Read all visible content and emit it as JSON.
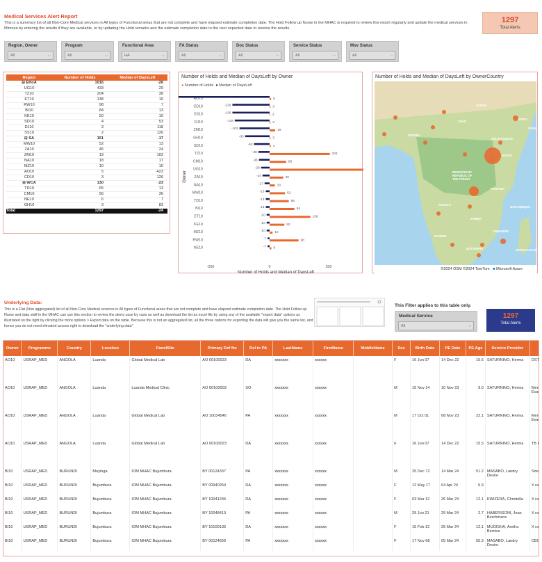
{
  "header": {
    "title": "Medical Services Alert Report",
    "description": "This is a summary list of all Non-Core Medical services in All types of Functional areas that are not complete and have elapsed estimate completion date. The Hold Follow up Nurse in the MHAC is required to review this report regularly and update the medical services in Mimosa by entering the results if they are available, or by updating the Hold remarks and the estimate completion date to the next expected date to receive the results.",
    "kpi_value": "1297",
    "kpi_label": "Total Alerts"
  },
  "filters": [
    {
      "label": "Region, Owner",
      "value": "All"
    },
    {
      "label": "Program",
      "value": "All"
    },
    {
      "label": "Functional Area",
      "value": "HA"
    },
    {
      "label": "FA Status",
      "value": "All"
    },
    {
      "label": "Doc Status",
      "value": "All"
    },
    {
      "label": "Service Status",
      "value": "All"
    },
    {
      "label": "Mov Status",
      "value": "All"
    }
  ],
  "region_table": {
    "headers": [
      "Region",
      "Number of Holds",
      "Median of DaysLeft"
    ],
    "rows": [
      {
        "name": "⊟ EHoA",
        "holds": "1016",
        "median": "-26",
        "group": true
      },
      {
        "name": "UG10",
        "holds": "433",
        "median": "29"
      },
      {
        "name": "TZ10",
        "holds": "204",
        "median": "38"
      },
      {
        "name": "ET10",
        "holds": "138",
        "median": "10"
      },
      {
        "name": "RW10",
        "holds": "98",
        "median": "7"
      },
      {
        "name": "BI10",
        "holds": "84",
        "median": "13"
      },
      {
        "name": "KE10",
        "holds": "50",
        "median": "10"
      },
      {
        "name": "SD10",
        "holds": "4",
        "median": "53"
      },
      {
        "name": "DJ10",
        "holds": "3",
        "median": "118"
      },
      {
        "name": "SS10",
        "holds": "2",
        "median": "126"
      },
      {
        "name": "⊟ SA",
        "holds": "151",
        "median": "-17",
        "group": true
      },
      {
        "name": "MW10",
        "holds": "52",
        "median": "13"
      },
      {
        "name": "ZA10",
        "holds": "46",
        "median": "24"
      },
      {
        "name": "ZM10",
        "holds": "19",
        "median": "102"
      },
      {
        "name": "NA10",
        "holds": "18",
        "median": "17"
      },
      {
        "name": "MZ10",
        "holds": "10",
        "median": "10"
      },
      {
        "name": "AO10",
        "holds": "5",
        "median": "-423"
      },
      {
        "name": "CD10",
        "holds": "3",
        "median": "126"
      },
      {
        "name": "⊟ WCA",
        "holds": "130",
        "median": "-23",
        "group": true
      },
      {
        "name": "TD10",
        "holds": "65",
        "median": "13"
      },
      {
        "name": "CM10",
        "holds": "56",
        "median": "36"
      },
      {
        "name": "NE10",
        "holds": "6",
        "median": "7"
      },
      {
        "name": "GH10",
        "holds": "3",
        "median": "83"
      }
    ],
    "total": {
      "name": "Total",
      "holds": "1297",
      "median": "-24"
    }
  },
  "bar_chart_title": "Number of Holds and Median of DaysLeft by Owner",
  "chart_data": {
    "type": "bar",
    "orientation": "horizontal",
    "title": "Number of Holds and Median of DaysLeft by Owner",
    "xlabel": "Number of Holds and Median of DaysLeft",
    "ylabel": "Owner",
    "xlim": [
      -400,
      400
    ],
    "x_ticks": [
      "-400",
      "-200",
      "0",
      "200",
      "400"
    ],
    "categories": [
      "AO10",
      "CD10",
      "SS10",
      "DJ10",
      "ZM10",
      "GH10",
      "SD10",
      "TZ10",
      "CM10",
      "UG10",
      "ZA10",
      "NA10",
      "MW10",
      "TD10",
      "BI10",
      "ET10",
      "KE10",
      "MZ10",
      "RW10",
      "NE10"
    ],
    "series": [
      {
        "name": "Number of Holds",
        "color": "#e8692e",
        "values": [
          5,
          3,
          2,
          3,
          19,
          3,
          4,
          204,
          56,
          433,
          46,
          18,
          52,
          65,
          84,
          138,
          50,
          10,
          98,
          6
        ]
      },
      {
        "name": "Median of DaysLeft",
        "color": "#1a1f5c",
        "values": [
          -423,
          -126,
          -126,
          -118,
          -102,
          -83,
          -53,
          -38,
          -36,
          -29,
          -24,
          -17,
          -13,
          -13,
          -13,
          -10,
          -10,
          -10,
          -7,
          -7
        ]
      }
    ],
    "holds_labels": [
      "5",
      "3",
      "2",
      "3",
      "19",
      "3",
      "4",
      "204",
      "56",
      "433",
      "46",
      "18",
      "52",
      "65",
      "84",
      "138",
      "50",
      "10",
      "98",
      "6"
    ],
    "median_labels": [
      "-423",
      "-126",
      "-126",
      "-118",
      "-102",
      "-83",
      "-53",
      "-38",
      "-36",
      "-29",
      "-24",
      "-17",
      "-13",
      "-13",
      "-13",
      "-10",
      "-10",
      "-10",
      "-7",
      "-7"
    ],
    "legend_position": "top-left"
  },
  "map": {
    "title": "Number of Holds and Median of DaysLeft by OwnerCountry",
    "labels": [
      "SUDAN",
      "ETHIOPIA",
      "SOMALIA",
      "NIGERIA",
      "DEMOCRATIC REPUBLIC OF THE CONGO",
      "KENYA",
      "TANZANIA",
      "ANGOLA",
      "ZAMBIA",
      "NAMIBIA",
      "ZIMBABWE",
      "MADAGASCAR",
      "BOTSWANA",
      "MOZAMBIQUE",
      "CHAD",
      "SOUTH SUDAN"
    ],
    "attribution": "©2024 OSM ©2024 TomTom",
    "brand": "Microsoft Azure"
  },
  "underlying": {
    "title": "Underlying Data:",
    "description": "This is a Flat (Non aggregated) list of all Non-Core Medical services in All types of Functional areas that are not complete and have elapsed estimate completion date. The Hold Follow up Nurse and data staff in the MHAC can use this section to review the alerts case by case as well as download the list as excel file by using any of the available \"export data\" options as illustrated on the right by clicking the more options > Export data on the table. Because this is not an aggregated list, all the three options for exporting the data will give you the same list, and hence you do not need elevated access right to download the \"underlying data\"",
    "filter_note": "This Filter applies to this table only.",
    "medical_service_label": "Medical Service",
    "medical_service_value": "All",
    "kpi_value": "1297",
    "kpi_label": "Total Alerts"
  },
  "detail_table": {
    "headers": [
      "Owner",
      "Programme",
      "Country",
      "Location",
      "PanelSite",
      "Primary Ref No",
      "Rel to PA",
      "LastName",
      "FirstName",
      "MiddleName",
      "Sex",
      "Birth Date",
      "PE Date",
      "PE Age",
      "Service Provider",
      ""
    ],
    "rows": [
      [
        "AO10",
        "USRAP_MED",
        "ANGOLA",
        "Luanda",
        "Global Medical Lab",
        "AO 00100023",
        "DA",
        "xxxxxxx",
        "xxxxxx",
        "",
        "F",
        "16 Jun 07",
        "14 Dec 22",
        "15.5",
        "SATURNINO, Herma",
        "DST"
      ],
      [
        "AO10",
        "USRAP_MED",
        "ANGOLA",
        "Luanda",
        "Luanda Medical Clinic",
        "AO 00100003",
        "SO",
        "xxxxxxx",
        "xxxxxx",
        "",
        "M",
        "15 Nov 14",
        "10 Nov 23",
        "9.0",
        "SATURNINO, Herma",
        "Men Eval"
      ],
      [
        "AO10",
        "USRAP_MED",
        "ANGOLA",
        "Luanda",
        "Global Medical Lab",
        "AO 10034546",
        "PA",
        "xxxxxxx",
        "xxxxxx",
        "",
        "M",
        "17 Oct 01",
        "08 Nov 23",
        "22.1",
        "SATURNINO, Herma",
        "Men Eval"
      ],
      [
        "AO10",
        "USRAP_MED",
        "ANGOLA",
        "Luanda",
        "Global Medical Lab",
        "AO 00100023",
        "DA",
        "xxxxxxx",
        "xxxxxx",
        "",
        "F",
        "16 Jun 07",
        "14 Dec 22",
        "15.5",
        "SATURNINO, Herma",
        "TB F"
      ],
      [
        "BI10",
        "USRAP_MED",
        "BURUNDI",
        "Muyinga",
        "IOM MHAC Bujumbura",
        "BY 00124337",
        "PA",
        "xxxxxxx",
        "xxxxxx",
        "",
        "M",
        "25 Dec 72",
        "14 Mar 24",
        "51.2",
        "MASABO, Landry Desire",
        "Sme"
      ],
      [
        "BI10",
        "USRAP_MED",
        "BURUNDI",
        "Bujumbura",
        "IOM MHAC Bujumbura",
        "BY 00940254",
        "DA",
        "xxxxxxx",
        "xxxxxx",
        "",
        "F",
        "12 May 17",
        "04 Apr 24",
        "6.9",
        "",
        "X ra"
      ],
      [
        "BI10",
        "USRAP_MED",
        "BURUNDI",
        "Bujumbura",
        "IOM MHAC Bujumbura",
        "BY 10041245",
        "DA",
        "xxxxxxx",
        "xxxxxx",
        "",
        "F",
        "03 Mar 12",
        "26 Mar 24",
        "12.1",
        "KWIZERA, Christella",
        "X ra"
      ],
      [
        "BI10",
        "USRAP_MED",
        "BURUNDI",
        "Bujumbura",
        "IOM MHAC Bujumbura",
        "BY 10048413",
        "PA",
        "xxxxxxx",
        "xxxxxx",
        "",
        "M",
        "29 Jun 21",
        "29 Mar 24",
        "2.7",
        "HABERISONI, Jean Berchmans",
        "X ra"
      ],
      [
        "BI10",
        "USRAP_MED",
        "BURUNDI",
        "Bujumbura",
        "IOM MHAC Bujumbura",
        "BY 10100135",
        "DA",
        "xxxxxxx",
        "xxxxxx",
        "",
        "F",
        "15 Feb 12",
        "25 Mar 24",
        "12.1",
        "MUGISHA, Aretha Bernice",
        "X ra"
      ],
      [
        "BI10",
        "USRAP_MED",
        "BURUNDI",
        "Bujumbura",
        "IOM MHAC Bujumbura",
        "BY 00124659",
        "PA",
        "xxxxxxx",
        "xxxxxx",
        "",
        "F",
        "17 Nov 68",
        "05 Mar 24",
        "55.3",
        "MASABO, Landry Desire",
        "CBC"
      ]
    ]
  }
}
